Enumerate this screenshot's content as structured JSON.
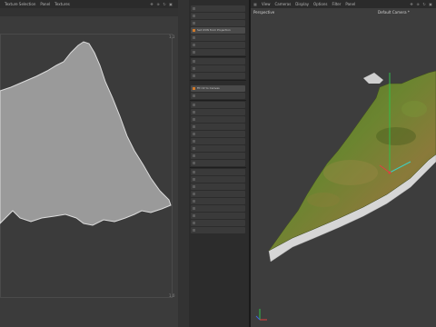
{
  "uv_editor": {
    "menu": [
      "Texture Selection",
      "Panel",
      "Textures"
    ],
    "corner_top_right": "1,1",
    "corner_bottom_right": "1,0"
  },
  "command_panel": {
    "items": [
      {
        "label": "Set UVW from Projection",
        "active": true
      },
      {
        "label": "Fit UV to Canvas",
        "active": true
      }
    ]
  },
  "viewport": {
    "menu": [
      "View",
      "Cameras",
      "Display",
      "Options",
      "Filter",
      "Panel"
    ],
    "view_label": "Perspective",
    "camera_label": "Default Camera",
    "camera_marker": "*"
  },
  "colors": {
    "accent": "#d07a2b",
    "terrain_green": "#5f7a2a",
    "uv_mesh": "#9a9a9a"
  }
}
